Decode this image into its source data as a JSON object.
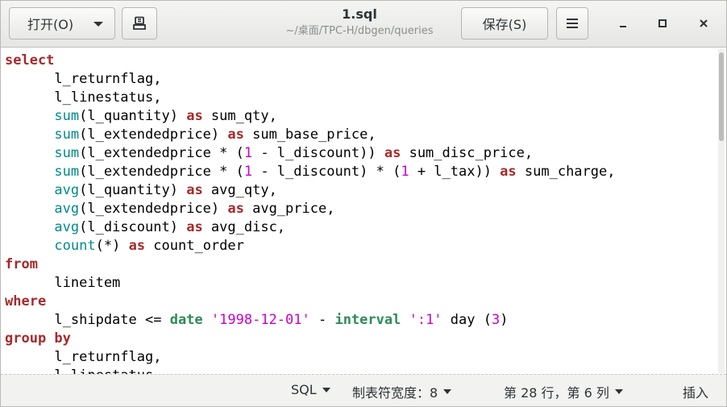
{
  "header": {
    "open_label": "打开(O)",
    "title": "1.sql",
    "subtitle": "~/桌面/TPC-H/dbgen/queries",
    "save_label": "保存(S)"
  },
  "editor": {
    "language": "SQL",
    "lines": [
      [
        {
          "t": "select",
          "c": "kw"
        }
      ],
      [
        {
          "t": "      l_returnflag,",
          "c": "plain"
        }
      ],
      [
        {
          "t": "      l_linestatus,",
          "c": "plain"
        }
      ],
      [
        {
          "t": "      ",
          "c": "plain"
        },
        {
          "t": "sum",
          "c": "fn"
        },
        {
          "t": "(l_quantity) ",
          "c": "plain"
        },
        {
          "t": "as",
          "c": "kw"
        },
        {
          "t": " sum_qty,",
          "c": "plain"
        }
      ],
      [
        {
          "t": "      ",
          "c": "plain"
        },
        {
          "t": "sum",
          "c": "fn"
        },
        {
          "t": "(l_extendedprice) ",
          "c": "plain"
        },
        {
          "t": "as",
          "c": "kw"
        },
        {
          "t": " sum_base_price,",
          "c": "plain"
        }
      ],
      [
        {
          "t": "      ",
          "c": "plain"
        },
        {
          "t": "sum",
          "c": "fn"
        },
        {
          "t": "(l_extendedprice * (",
          "c": "plain"
        },
        {
          "t": "1",
          "c": "num"
        },
        {
          "t": " - l_discount)) ",
          "c": "plain"
        },
        {
          "t": "as",
          "c": "kw"
        },
        {
          "t": " sum_disc_price,",
          "c": "plain"
        }
      ],
      [
        {
          "t": "      ",
          "c": "plain"
        },
        {
          "t": "sum",
          "c": "fn"
        },
        {
          "t": "(l_extendedprice * (",
          "c": "plain"
        },
        {
          "t": "1",
          "c": "num"
        },
        {
          "t": " - l_discount) * (",
          "c": "plain"
        },
        {
          "t": "1",
          "c": "num"
        },
        {
          "t": " + l_tax)) ",
          "c": "plain"
        },
        {
          "t": "as",
          "c": "kw"
        },
        {
          "t": " sum_charge,",
          "c": "plain"
        }
      ],
      [
        {
          "t": "      ",
          "c": "plain"
        },
        {
          "t": "avg",
          "c": "fn"
        },
        {
          "t": "(l_quantity) ",
          "c": "plain"
        },
        {
          "t": "as",
          "c": "kw"
        },
        {
          "t": " avg_qty,",
          "c": "plain"
        }
      ],
      [
        {
          "t": "      ",
          "c": "plain"
        },
        {
          "t": "avg",
          "c": "fn"
        },
        {
          "t": "(l_extendedprice) ",
          "c": "plain"
        },
        {
          "t": "as",
          "c": "kw"
        },
        {
          "t": " avg_price,",
          "c": "plain"
        }
      ],
      [
        {
          "t": "      ",
          "c": "plain"
        },
        {
          "t": "avg",
          "c": "fn"
        },
        {
          "t": "(l_discount) ",
          "c": "plain"
        },
        {
          "t": "as",
          "c": "kw"
        },
        {
          "t": " avg_disc,",
          "c": "plain"
        }
      ],
      [
        {
          "t": "      ",
          "c": "plain"
        },
        {
          "t": "count",
          "c": "fn"
        },
        {
          "t": "(*) ",
          "c": "plain"
        },
        {
          "t": "as",
          "c": "kw"
        },
        {
          "t": " count_order",
          "c": "plain"
        }
      ],
      [
        {
          "t": "from",
          "c": "kw"
        }
      ],
      [
        {
          "t": "      lineitem",
          "c": "plain"
        }
      ],
      [
        {
          "t": "where",
          "c": "kw"
        }
      ],
      [
        {
          "t": "      l_shipdate <= ",
          "c": "plain"
        },
        {
          "t": "date",
          "c": "ty"
        },
        {
          "t": " ",
          "c": "plain"
        },
        {
          "t": "'1998-12-01'",
          "c": "str"
        },
        {
          "t": " - ",
          "c": "plain"
        },
        {
          "t": "interval",
          "c": "ty"
        },
        {
          "t": " ",
          "c": "plain"
        },
        {
          "t": "':1'",
          "c": "str"
        },
        {
          "t": " day (",
          "c": "plain"
        },
        {
          "t": "3",
          "c": "num"
        },
        {
          "t": ")",
          "c": "plain"
        }
      ],
      [
        {
          "t": "group by",
          "c": "kw"
        }
      ],
      [
        {
          "t": "      l_returnflag,",
          "c": "plain"
        }
      ],
      [
        {
          "t": "      l_linestatus",
          "c": "plain"
        }
      ]
    ]
  },
  "statusbar": {
    "language": "SQL",
    "tab_width": "制表符宽度：8",
    "cursor_position": "第 28 行，第 6 列",
    "insert_mode": "插入"
  },
  "colors": {
    "keyword": "#a52a2a",
    "function": "#008a8c",
    "number": "#c800c8",
    "string": "#c800c8",
    "type": "#2e8b57"
  },
  "icons": {
    "pin": "pin-document-icon",
    "menu": "hamburger-menu-icon",
    "minimize": "minimize-icon",
    "maximize": "maximize-icon",
    "close": "close-icon"
  }
}
